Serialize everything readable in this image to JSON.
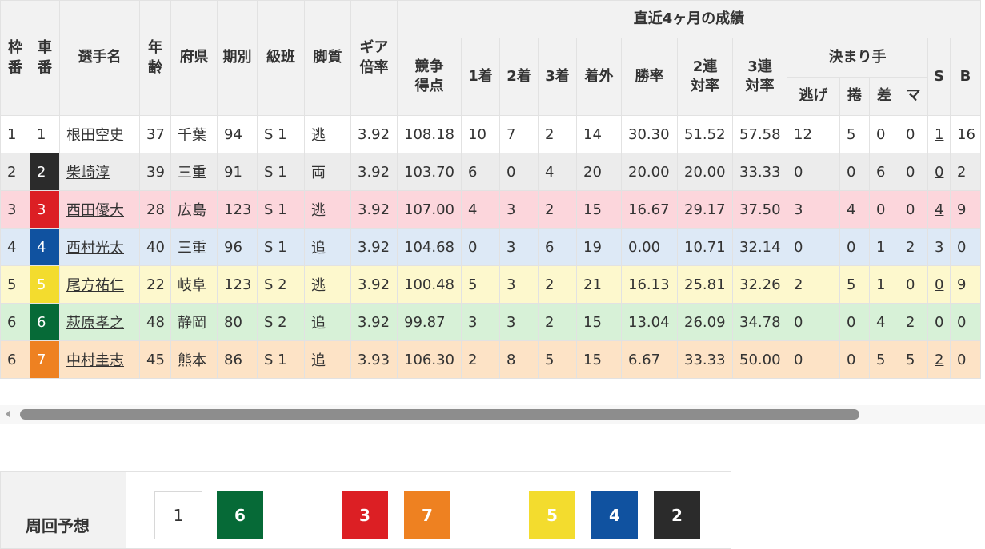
{
  "headers": {
    "waku": "枠番",
    "sha": "車番",
    "name": "選手名",
    "age": "年齢",
    "pref": "府県",
    "term": "期別",
    "class": "級班",
    "style": "脚質",
    "gear": "ギア倍率",
    "recent": "直近4ヶ月の成績",
    "score": "競争得点",
    "first": "1着",
    "second": "2着",
    "third": "3着",
    "out": "着外",
    "win": "勝率",
    "ren2": "2連対率",
    "ren3": "3連対率",
    "kimarite": "決まり手",
    "nige": "逃げ",
    "makuri": "捲",
    "sashi": "差",
    "mark": "マ",
    "s": "S",
    "b": "B"
  },
  "riders": [
    {
      "waku": "1",
      "car": "1",
      "name": "根田空史",
      "age": "37",
      "pref": "千葉",
      "term": "94",
      "cls": "S 1",
      "style": "逃",
      "gear": "3.92",
      "score": "108.18",
      "f1": "10",
      "f2": "7",
      "f3": "2",
      "out": "14",
      "win": "30.30",
      "r2": "51.52",
      "r3": "57.58",
      "nige": "12",
      "makuri": "5",
      "sashi": "0",
      "mark": "0",
      "s": "1",
      "b": "16"
    },
    {
      "waku": "2",
      "car": "2",
      "name": "柴崎淳",
      "age": "39",
      "pref": "三重",
      "term": "91",
      "cls": "S 1",
      "style": "両",
      "gear": "3.92",
      "score": "103.70",
      "f1": "6",
      "f2": "0",
      "f3": "4",
      "out": "20",
      "win": "20.00",
      "r2": "20.00",
      "r3": "33.33",
      "nige": "0",
      "makuri": "0",
      "sashi": "6",
      "mark": "0",
      "s": "0",
      "b": "2"
    },
    {
      "waku": "3",
      "car": "3",
      "name": "西田優大",
      "age": "28",
      "pref": "広島",
      "term": "123",
      "cls": "S 1",
      "style": "逃",
      "gear": "3.92",
      "score": "107.00",
      "f1": "4",
      "f2": "3",
      "f3": "2",
      "out": "15",
      "win": "16.67",
      "r2": "29.17",
      "r3": "37.50",
      "nige": "3",
      "makuri": "4",
      "sashi": "0",
      "mark": "0",
      "s": "4",
      "b": "9"
    },
    {
      "waku": "4",
      "car": "4",
      "name": "西村光太",
      "age": "40",
      "pref": "三重",
      "term": "96",
      "cls": "S 1",
      "style": "追",
      "gear": "3.92",
      "score": "104.68",
      "f1": "0",
      "f2": "3",
      "f3": "6",
      "out": "19",
      "win": "0.00",
      "r2": "10.71",
      "r3": "32.14",
      "nige": "0",
      "makuri": "0",
      "sashi": "1",
      "mark": "2",
      "s": "3",
      "b": "0"
    },
    {
      "waku": "5",
      "car": "5",
      "name": "尾方祐仁",
      "age": "22",
      "pref": "岐阜",
      "term": "123",
      "cls": "S 2",
      "style": "逃",
      "gear": "3.92",
      "score": "100.48",
      "f1": "5",
      "f2": "3",
      "f3": "2",
      "out": "21",
      "win": "16.13",
      "r2": "25.81",
      "r3": "32.26",
      "nige": "2",
      "makuri": "5",
      "sashi": "1",
      "mark": "0",
      "s": "0",
      "b": "9"
    },
    {
      "waku": "6",
      "car": "6",
      "name": "萩原孝之",
      "age": "48",
      "pref": "静岡",
      "term": "80",
      "cls": "S 2",
      "style": "追",
      "gear": "3.92",
      "score": "99.87",
      "f1": "3",
      "f2": "3",
      "f3": "2",
      "out": "15",
      "win": "13.04",
      "r2": "26.09",
      "r3": "34.78",
      "nige": "0",
      "makuri": "0",
      "sashi": "4",
      "mark": "2",
      "s": "0",
      "b": "0"
    },
    {
      "waku": "6",
      "car": "7",
      "name": "中村圭志",
      "age": "45",
      "pref": "熊本",
      "term": "86",
      "cls": "S 1",
      "style": "追",
      "gear": "3.93",
      "score": "106.30",
      "f1": "2",
      "f2": "8",
      "f3": "5",
      "out": "15",
      "win": "6.67",
      "r2": "33.33",
      "r3": "50.00",
      "nige": "0",
      "makuri": "0",
      "sashi": "5",
      "mark": "5",
      "s": "2",
      "b": "0"
    }
  ],
  "prediction": {
    "label": "周回予想",
    "order": [
      "1",
      "6",
      "3",
      "7",
      "5",
      "4",
      "2"
    ]
  },
  "car_colors": {
    "1": "#ffffff",
    "2": "#2b2b2b",
    "3": "#dc1f24",
    "4": "#1052a0",
    "5": "#f3dc2e",
    "6": "#066a37",
    "7": "#ee8121"
  }
}
